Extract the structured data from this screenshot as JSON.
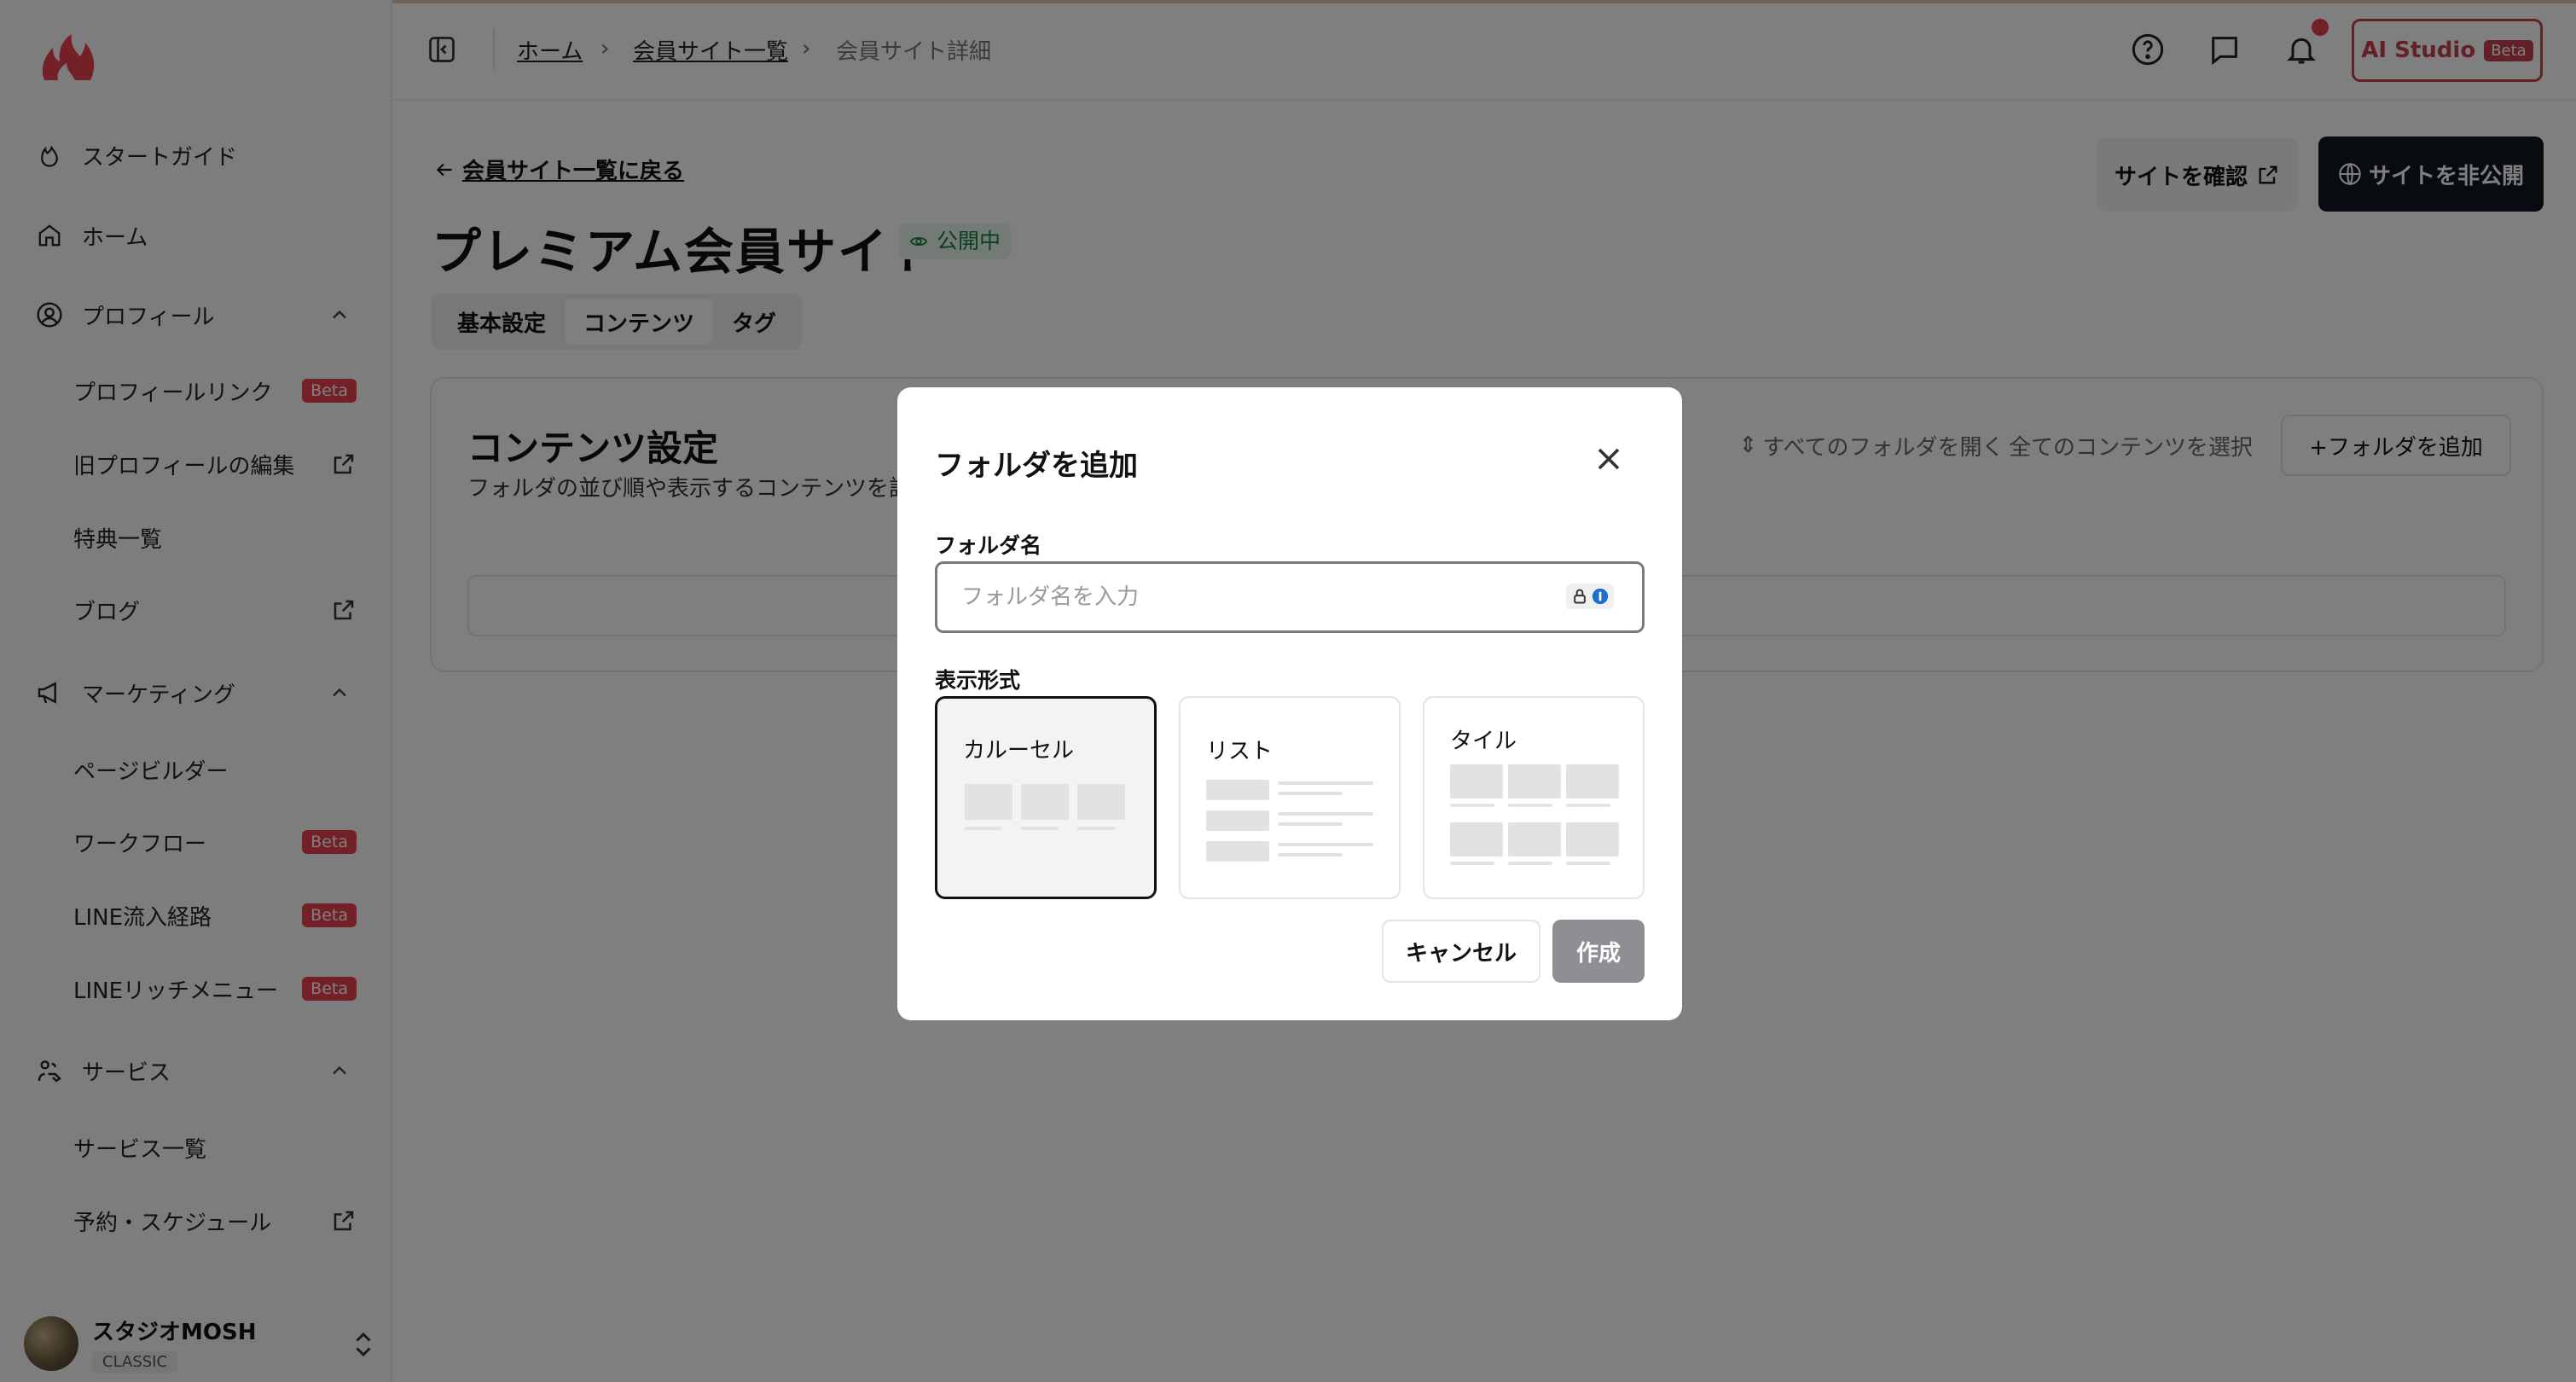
{
  "sidebar": {
    "start_guide": "スタートガイド",
    "home": "ホーム",
    "profile": {
      "label": "プロフィール",
      "items": [
        {
          "label": "プロフィールリンク",
          "badge": "Beta"
        },
        {
          "label": "旧プロフィールの編集"
        },
        {
          "label": "特典一覧"
        },
        {
          "label": "ブログ"
        }
      ]
    },
    "marketing": {
      "label": "マーケティング",
      "items": [
        {
          "label": "ページビルダー"
        },
        {
          "label": "ワークフロー",
          "badge": "Beta"
        },
        {
          "label": "LINE流入経路",
          "badge": "Beta"
        },
        {
          "label": "LINEリッチメニュー",
          "badge": "Beta"
        }
      ]
    },
    "service": {
      "label": "サービス",
      "items": [
        {
          "label": "サービス一覧"
        },
        {
          "label": "予約・スケジュール"
        }
      ]
    },
    "user": {
      "name": "スタジオMOSH",
      "plan": "CLASSIC"
    }
  },
  "topbar": {
    "breadcrumb": [
      "ホーム",
      "会員サイト一覧",
      "会員サイト詳細"
    ],
    "ai_studio": "AI Studio",
    "ai_badge": "Beta"
  },
  "main": {
    "back_link": "会員サイト一覧に戻る",
    "title": "プレミアム会員サイト",
    "status": "公開中",
    "tabs": [
      "基本設定",
      "コンテンツ",
      "タグ"
    ],
    "active_tab": "コンテンツ",
    "view_site": "サイトを確認",
    "unpublish": "サイトを非公開",
    "card": {
      "title": "コンテンツ設定",
      "description": "フォルダの並び順や表示するコンテンツを設",
      "open_all": "すべてのフォルダを開く",
      "select_all": "全てのコンテンツを選択",
      "add_folder": "+フォルダを追加"
    }
  },
  "modal": {
    "title": "フォルダを追加",
    "name_label": "フォルダ名",
    "name_value": "",
    "name_placeholder": "フォルダ名を入力",
    "format_label": "表示形式",
    "options": [
      "カルーセル",
      "リスト",
      "タイル"
    ],
    "selected_option": "カルーセル",
    "cancel": "キャンセル",
    "create": "作成"
  },
  "colors": {
    "brand": "#e8414f",
    "dark_button": "#101820",
    "disabled_button": "#8e8e93",
    "status_green": "#16803c"
  },
  "icons": [
    "logo-icon",
    "flame-icon",
    "home-icon",
    "user-circle-icon",
    "megaphone-icon",
    "service-icon",
    "external-link-icon",
    "sidebar-toggle-icon",
    "help-icon",
    "chat-icon",
    "bell-icon",
    "eye-icon",
    "globe-icon",
    "arrow-left-icon",
    "chevron-up-icon",
    "updown-icon",
    "close-icon",
    "password-manager-icon"
  ]
}
